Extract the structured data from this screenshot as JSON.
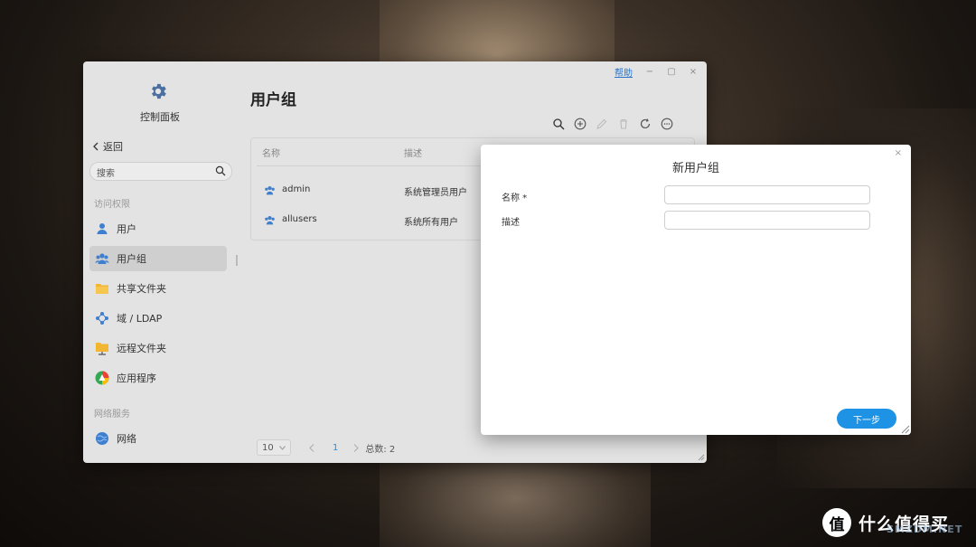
{
  "window": {
    "help_label": "帮助",
    "minimize_label": "−",
    "maximize_label": "▢",
    "close_label": "×"
  },
  "sidebar": {
    "app_label": "控制面板",
    "back_label": "返回",
    "search_placeholder": "搜索",
    "section_access": "访问权限",
    "section_network": "网络服务",
    "items": [
      {
        "label": "用户",
        "icon": "user-icon"
      },
      {
        "label": "用户组",
        "icon": "user-group-icon"
      },
      {
        "label": "共享文件夹",
        "icon": "folder-icon"
      },
      {
        "label": "域 / LDAP",
        "icon": "domain-icon"
      },
      {
        "label": "远程文件夹",
        "icon": "remote-folder-icon"
      },
      {
        "label": "应用程序",
        "icon": "app-icon"
      },
      {
        "label": "网络",
        "icon": "globe-icon"
      }
    ],
    "active_index": 1
  },
  "main": {
    "title": "用户组",
    "table": {
      "headers": [
        "名称",
        "描述"
      ],
      "rows": [
        {
          "name": "admin",
          "desc": "系统管理员用户"
        },
        {
          "name": "allusers",
          "desc": "系统所有用户"
        }
      ]
    },
    "pager": {
      "page_size": "10",
      "current_page": "1",
      "total": "总数: 2"
    }
  },
  "dialog": {
    "title": "新用户组",
    "close_label": "×",
    "name_label": "名称 *",
    "name_value": "",
    "desc_label": "描述",
    "desc_value": "",
    "next_label": "下一步"
  },
  "watermark": {
    "logo": "值",
    "text": "什么值得买",
    "url": "SMZDM.NET"
  },
  "colors": {
    "accent": "#1e93e6",
    "link": "#2b74c7",
    "icon_blue": "#3e7fd0",
    "folder_yellow": "#f2b632"
  }
}
